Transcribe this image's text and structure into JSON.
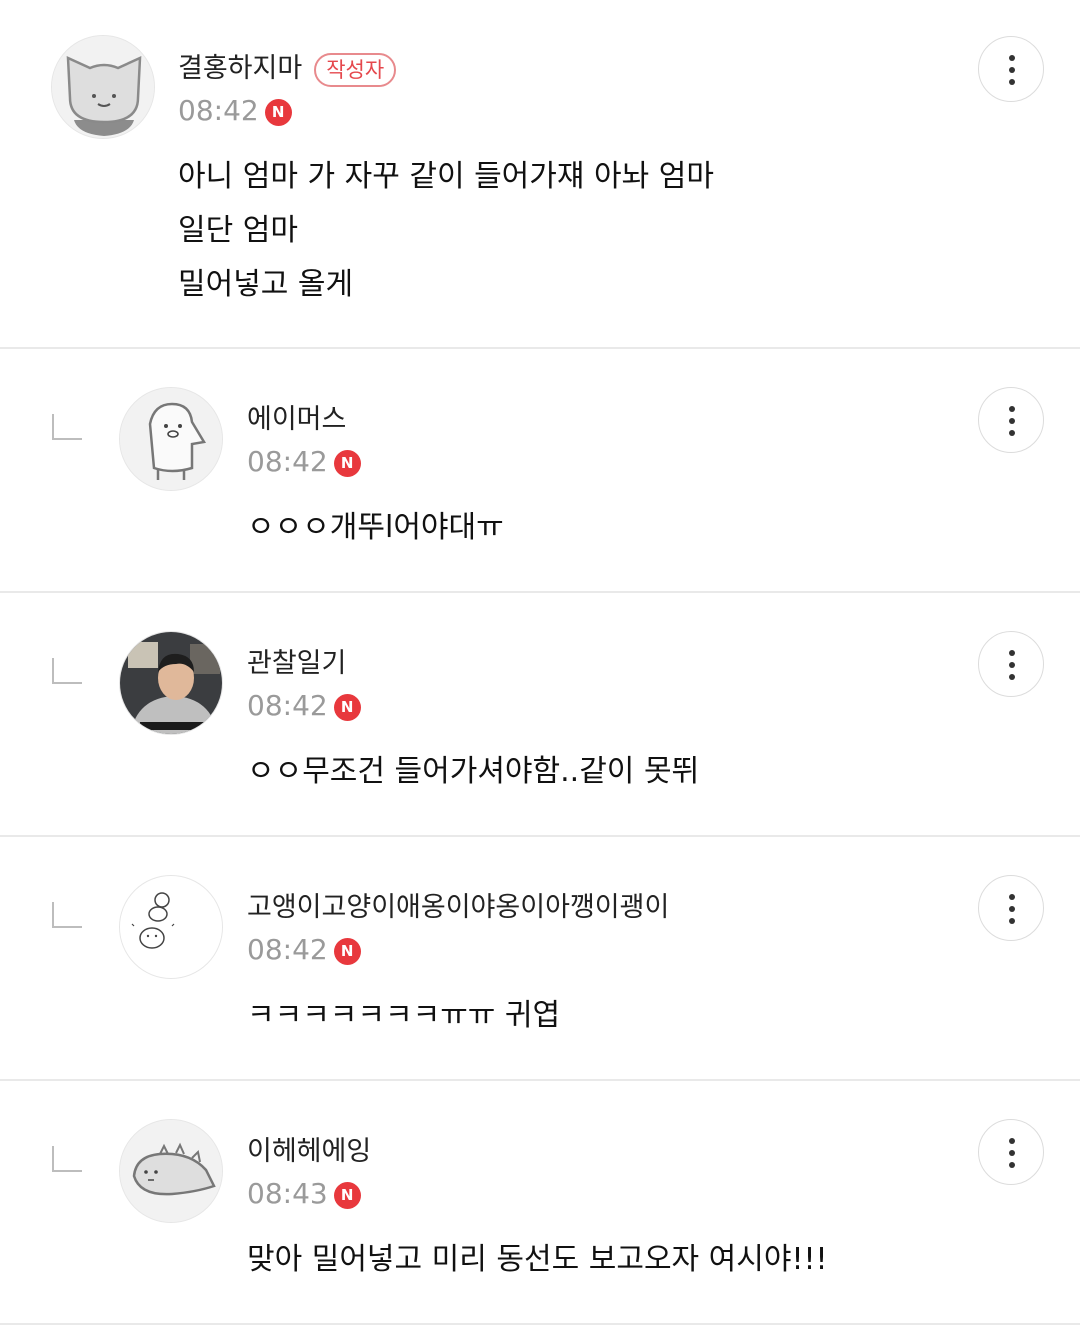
{
  "comments": [
    {
      "author": "결홍하지마",
      "author_badge": "작성자",
      "time": "08:42",
      "new_badge": "N",
      "text": "아니 엄마 가 자꾸 같이 들어가쟤 아놔 엄마\n일단 엄마\n밀어넣고 올게",
      "avatar": "cat-avatar",
      "is_reply": false
    },
    {
      "author": "에이머스",
      "time": "08:42",
      "new_badge": "N",
      "text": "ㅇㅇㅇ개뚜l어야대ㅠ",
      "avatar": "penguin-avatar",
      "is_reply": true
    },
    {
      "author": "관찰일기",
      "time": "08:42",
      "new_badge": "N",
      "text": "ㅇㅇ무조건 들어가셔야함..같이 못뛰",
      "avatar": "photo-avatar",
      "is_reply": true
    },
    {
      "author": "고앵이고양이애옹이야옹이아깽이괭이",
      "time": "08:42",
      "new_badge": "N",
      "text": "ㅋㅋㅋㅋㅋㅋㅋㅠㅠ 귀엽",
      "avatar": "doodle-avatar",
      "is_reply": true
    },
    {
      "author": "이헤헤에잉",
      "time": "08:43",
      "new_badge": "N",
      "text": "맞아 밀어넣고 미리 동선도 보고오자 여시야!!!",
      "avatar": "dinosaur-avatar",
      "is_reply": true
    }
  ],
  "colors": {
    "new_badge": "#e8383d",
    "author_badge": "#e5484d",
    "time": "#9a9a9a",
    "divider": "#e9e9e9"
  }
}
